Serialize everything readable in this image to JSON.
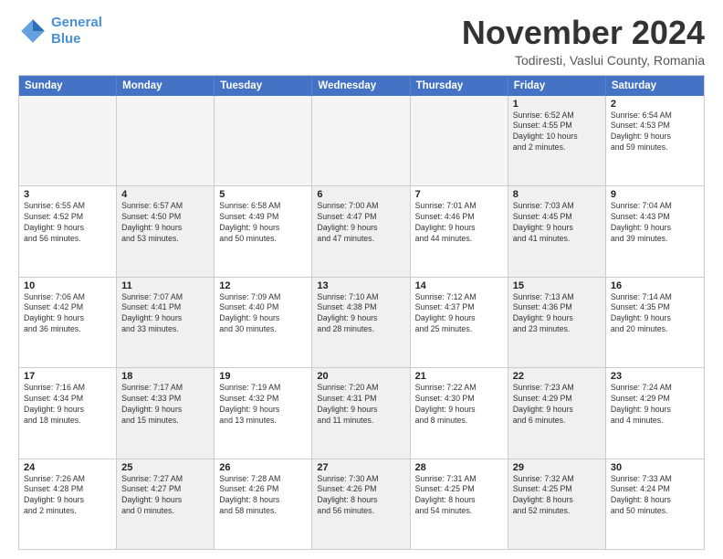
{
  "logo": {
    "line1": "General",
    "line2": "Blue"
  },
  "title": "November 2024",
  "subtitle": "Todiresti, Vaslui County, Romania",
  "header_days": [
    "Sunday",
    "Monday",
    "Tuesday",
    "Wednesday",
    "Thursday",
    "Friday",
    "Saturday"
  ],
  "rows": [
    [
      {
        "day": "",
        "info": "",
        "empty": true
      },
      {
        "day": "",
        "info": "",
        "empty": true
      },
      {
        "day": "",
        "info": "",
        "empty": true
      },
      {
        "day": "",
        "info": "",
        "empty": true
      },
      {
        "day": "",
        "info": "",
        "empty": true
      },
      {
        "day": "1",
        "info": "Sunrise: 6:52 AM\nSunset: 4:55 PM\nDaylight: 10 hours\nand 2 minutes.",
        "shaded": true
      },
      {
        "day": "2",
        "info": "Sunrise: 6:54 AM\nSunset: 4:53 PM\nDaylight: 9 hours\nand 59 minutes.",
        "shaded": false
      }
    ],
    [
      {
        "day": "3",
        "info": "Sunrise: 6:55 AM\nSunset: 4:52 PM\nDaylight: 9 hours\nand 56 minutes.",
        "shaded": false
      },
      {
        "day": "4",
        "info": "Sunrise: 6:57 AM\nSunset: 4:50 PM\nDaylight: 9 hours\nand 53 minutes.",
        "shaded": true
      },
      {
        "day": "5",
        "info": "Sunrise: 6:58 AM\nSunset: 4:49 PM\nDaylight: 9 hours\nand 50 minutes.",
        "shaded": false
      },
      {
        "day": "6",
        "info": "Sunrise: 7:00 AM\nSunset: 4:47 PM\nDaylight: 9 hours\nand 47 minutes.",
        "shaded": true
      },
      {
        "day": "7",
        "info": "Sunrise: 7:01 AM\nSunset: 4:46 PM\nDaylight: 9 hours\nand 44 minutes.",
        "shaded": false
      },
      {
        "day": "8",
        "info": "Sunrise: 7:03 AM\nSunset: 4:45 PM\nDaylight: 9 hours\nand 41 minutes.",
        "shaded": true
      },
      {
        "day": "9",
        "info": "Sunrise: 7:04 AM\nSunset: 4:43 PM\nDaylight: 9 hours\nand 39 minutes.",
        "shaded": false
      }
    ],
    [
      {
        "day": "10",
        "info": "Sunrise: 7:06 AM\nSunset: 4:42 PM\nDaylight: 9 hours\nand 36 minutes.",
        "shaded": false
      },
      {
        "day": "11",
        "info": "Sunrise: 7:07 AM\nSunset: 4:41 PM\nDaylight: 9 hours\nand 33 minutes.",
        "shaded": true
      },
      {
        "day": "12",
        "info": "Sunrise: 7:09 AM\nSunset: 4:40 PM\nDaylight: 9 hours\nand 30 minutes.",
        "shaded": false
      },
      {
        "day": "13",
        "info": "Sunrise: 7:10 AM\nSunset: 4:38 PM\nDaylight: 9 hours\nand 28 minutes.",
        "shaded": true
      },
      {
        "day": "14",
        "info": "Sunrise: 7:12 AM\nSunset: 4:37 PM\nDaylight: 9 hours\nand 25 minutes.",
        "shaded": false
      },
      {
        "day": "15",
        "info": "Sunrise: 7:13 AM\nSunset: 4:36 PM\nDaylight: 9 hours\nand 23 minutes.",
        "shaded": true
      },
      {
        "day": "16",
        "info": "Sunrise: 7:14 AM\nSunset: 4:35 PM\nDaylight: 9 hours\nand 20 minutes.",
        "shaded": false
      }
    ],
    [
      {
        "day": "17",
        "info": "Sunrise: 7:16 AM\nSunset: 4:34 PM\nDaylight: 9 hours\nand 18 minutes.",
        "shaded": false
      },
      {
        "day": "18",
        "info": "Sunrise: 7:17 AM\nSunset: 4:33 PM\nDaylight: 9 hours\nand 15 minutes.",
        "shaded": true
      },
      {
        "day": "19",
        "info": "Sunrise: 7:19 AM\nSunset: 4:32 PM\nDaylight: 9 hours\nand 13 minutes.",
        "shaded": false
      },
      {
        "day": "20",
        "info": "Sunrise: 7:20 AM\nSunset: 4:31 PM\nDaylight: 9 hours\nand 11 minutes.",
        "shaded": true
      },
      {
        "day": "21",
        "info": "Sunrise: 7:22 AM\nSunset: 4:30 PM\nDaylight: 9 hours\nand 8 minutes.",
        "shaded": false
      },
      {
        "day": "22",
        "info": "Sunrise: 7:23 AM\nSunset: 4:29 PM\nDaylight: 9 hours\nand 6 minutes.",
        "shaded": true
      },
      {
        "day": "23",
        "info": "Sunrise: 7:24 AM\nSunset: 4:29 PM\nDaylight: 9 hours\nand 4 minutes.",
        "shaded": false
      }
    ],
    [
      {
        "day": "24",
        "info": "Sunrise: 7:26 AM\nSunset: 4:28 PM\nDaylight: 9 hours\nand 2 minutes.",
        "shaded": false
      },
      {
        "day": "25",
        "info": "Sunrise: 7:27 AM\nSunset: 4:27 PM\nDaylight: 9 hours\nand 0 minutes.",
        "shaded": true
      },
      {
        "day": "26",
        "info": "Sunrise: 7:28 AM\nSunset: 4:26 PM\nDaylight: 8 hours\nand 58 minutes.",
        "shaded": false
      },
      {
        "day": "27",
        "info": "Sunrise: 7:30 AM\nSunset: 4:26 PM\nDaylight: 8 hours\nand 56 minutes.",
        "shaded": true
      },
      {
        "day": "28",
        "info": "Sunrise: 7:31 AM\nSunset: 4:25 PM\nDaylight: 8 hours\nand 54 minutes.",
        "shaded": false
      },
      {
        "day": "29",
        "info": "Sunrise: 7:32 AM\nSunset: 4:25 PM\nDaylight: 8 hours\nand 52 minutes.",
        "shaded": true
      },
      {
        "day": "30",
        "info": "Sunrise: 7:33 AM\nSunset: 4:24 PM\nDaylight: 8 hours\nand 50 minutes.",
        "shaded": false
      }
    ]
  ]
}
